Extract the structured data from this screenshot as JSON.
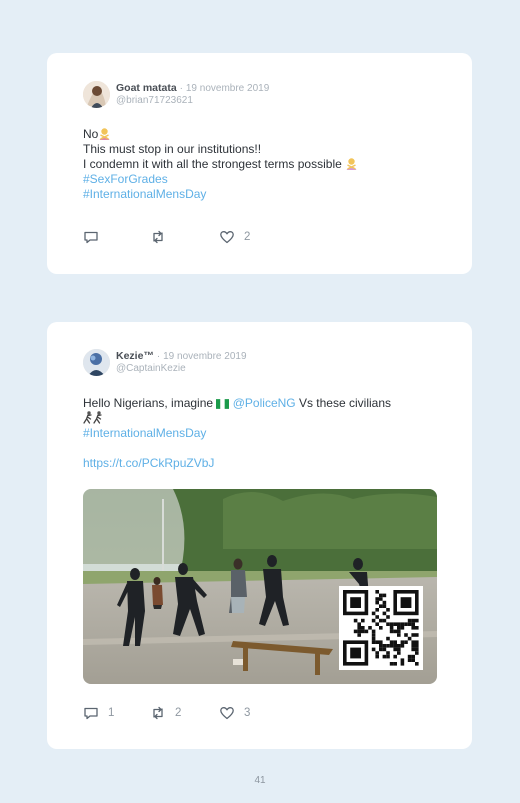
{
  "tweets": [
    {
      "author": {
        "display_name": "Goat matata",
        "handle": "@brian71723621"
      },
      "separator": "·",
      "date": "19 novembre 2019",
      "text_lines": [
        {
          "text": "No",
          "emoji": "woman-gesturing-no-emoji"
        },
        {
          "text": "This must stop in our institutions!!"
        },
        {
          "text": "I condemn it with all the strongest terms possible ",
          "emoji": "woman-gesturing-no-emoji"
        }
      ],
      "hashtags": [
        "#SexForGrades",
        "#InternationalMensDay"
      ],
      "actions": {
        "reply_count": "",
        "retweet_count": "",
        "like_count": "2"
      }
    },
    {
      "author": {
        "display_name": "Kezie™",
        "handle": "@CaptainKezie"
      },
      "separator": "·",
      "date": "19 novembre 2019",
      "text_prefix": "Hello Nigerians, imagine ",
      "flag_emoji": "nigeria-flag-emoji",
      "mention": "@PoliceNG",
      "text_suffix": " Vs these civilians",
      "running_emojis": [
        "person-running-emoji",
        "person-running-emoji"
      ],
      "hashtags": [
        "#InternationalMensDay"
      ],
      "link": "https://t.co/PCkRpuZVbJ",
      "media": {
        "type": "video-still",
        "description_icon": "qr-code-icon"
      },
      "actions": {
        "reply_count": "1",
        "retweet_count": "2",
        "like_count": "3"
      }
    }
  ],
  "page": {
    "number": "41"
  },
  "colors": {
    "background": "#e4eef6",
    "card": "#ffffff",
    "link": "#5fb0e6",
    "text": "#2d3238",
    "muted": "#aab2ba"
  }
}
